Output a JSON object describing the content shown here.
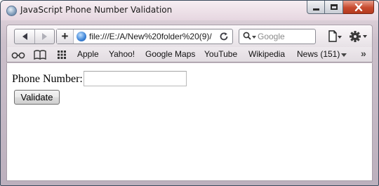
{
  "window": {
    "title": "JavaScript Phone Number Validation"
  },
  "toolbar": {
    "url": "file:///E:/A/New%20folder%20(9)/",
    "search_placeholder": "Google"
  },
  "bookmarks": [
    {
      "label": "Apple"
    },
    {
      "label": "Yahoo!"
    },
    {
      "label": "Google Maps"
    },
    {
      "label": "YouTube"
    },
    {
      "label": "Wikipedia"
    },
    {
      "label": "News (151)"
    }
  ],
  "form": {
    "phone_label": "Phone Number:",
    "phone_value": "",
    "validate_label": "Validate"
  },
  "icons": [
    "app-icon",
    "back-icon",
    "forward-icon",
    "plus-icon",
    "globe-icon",
    "reload-icon",
    "search-icon",
    "page-menu-icon",
    "gear-icon",
    "reading-glasses-icon",
    "book-icon",
    "grid-icon",
    "chevron-down-icon",
    "chevron-right-double-icon"
  ]
}
